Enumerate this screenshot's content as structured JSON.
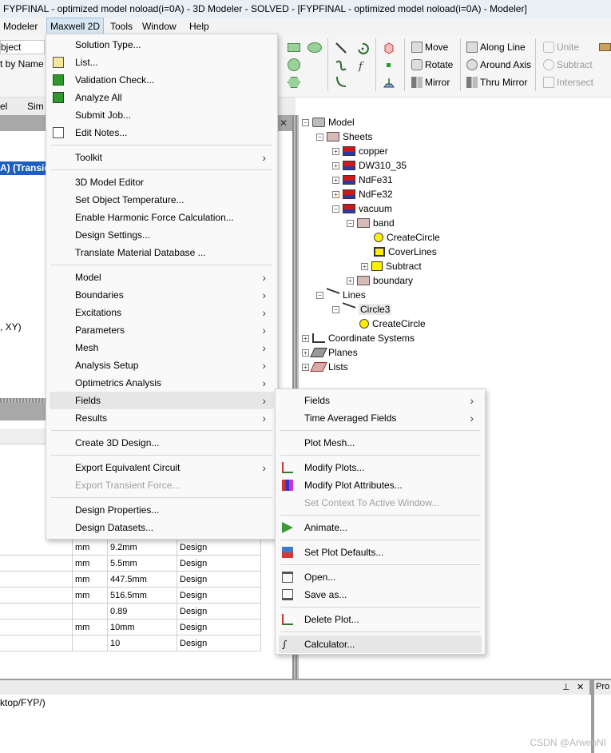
{
  "window": {
    "title": "FYPFINAL - optimized model noload(i=0A) - 3D Modeler - SOLVED - [FYPFINAL - optimized model noload(i=0A) - Modeler]"
  },
  "menubar": [
    "Modeler",
    "Maxwell 2D",
    "Tools",
    "Window",
    "Help"
  ],
  "left_fragments": {
    "select_value": "bject",
    "sort_label": "t by Name",
    "tab1": "el",
    "tab2": "Sim",
    "highlight_text": "A) (Transie",
    "coord_text": ", XY)",
    "path_text": "ktop/FYP/)"
  },
  "toolbar": {
    "move": "Move",
    "rotate": "Rotate",
    "mirror": "Mirror",
    "along_line": "Along Line",
    "around_axis": "Around Axis",
    "thru_mirror": "Thru Mirror",
    "unite": "Unite",
    "subtract": "Subtract",
    "intersect": "Intersect"
  },
  "tree": {
    "model": "Model",
    "sheets": "Sheets",
    "copper": "copper",
    "dw310": "DW310_35",
    "ndfe31": "NdFe31",
    "ndfe32": "NdFe32",
    "vacuum": "vacuum",
    "band": "band",
    "create_circle_1": "CreateCircle",
    "cover_lines": "CoverLines",
    "subtract": "Subtract",
    "boundary": "boundary",
    "lines": "Lines",
    "circle3": "Circle3",
    "create_circle_2": "CreateCircle",
    "coord_systems": "Coordinate Systems",
    "planes": "Planes",
    "lists": "Lists"
  },
  "properties_grid": {
    "rows": [
      {
        "unit": "mm",
        "value": "9.2mm",
        "type": "Design"
      },
      {
        "unit": "mm",
        "value": "5.5mm",
        "type": "Design"
      },
      {
        "unit": "mm",
        "value": "447.5mm",
        "type": "Design"
      },
      {
        "unit": "mm",
        "value": "516.5mm",
        "type": "Design"
      },
      {
        "unit": "",
        "value": "0.89",
        "type": "Design"
      },
      {
        "unit": "mm",
        "value": "10mm",
        "type": "Design"
      },
      {
        "unit": "",
        "value": "10",
        "type": "Design"
      }
    ]
  },
  "maxwell_menu": {
    "items": [
      "Solution Type...",
      "List...",
      "Validation Check...",
      "Analyze All",
      "Submit Job...",
      "Edit Notes...",
      "Toolkit",
      "3D Model Editor",
      "Set Object Temperature...",
      "Enable Harmonic Force Calculation...",
      "Design Settings...",
      "Translate Material Database ...",
      "Model",
      "Boundaries",
      "Excitations",
      "Parameters",
      "Mesh",
      "Analysis Setup",
      "Optimetrics Analysis",
      "Fields",
      "Results",
      "Create 3D Design...",
      "Export Equivalent Circuit",
      "Export Transient Force...",
      "Design Properties...",
      "Design Datasets..."
    ]
  },
  "fields_menu": {
    "items": [
      "Fields",
      "Time Averaged Fields",
      "Plot Mesh...",
      "Modify Plots...",
      "Modify Plot Attributes...",
      "Set Context To Active Window...",
      "Animate...",
      "Set Plot Defaults...",
      "Open...",
      "Save as...",
      "Delete Plot...",
      "Calculator..."
    ]
  },
  "panel_controls": {
    "close": "✕",
    "pin": "⊥",
    "right_tab": "Pro"
  },
  "watermark": "CSDN @ArwenNI"
}
